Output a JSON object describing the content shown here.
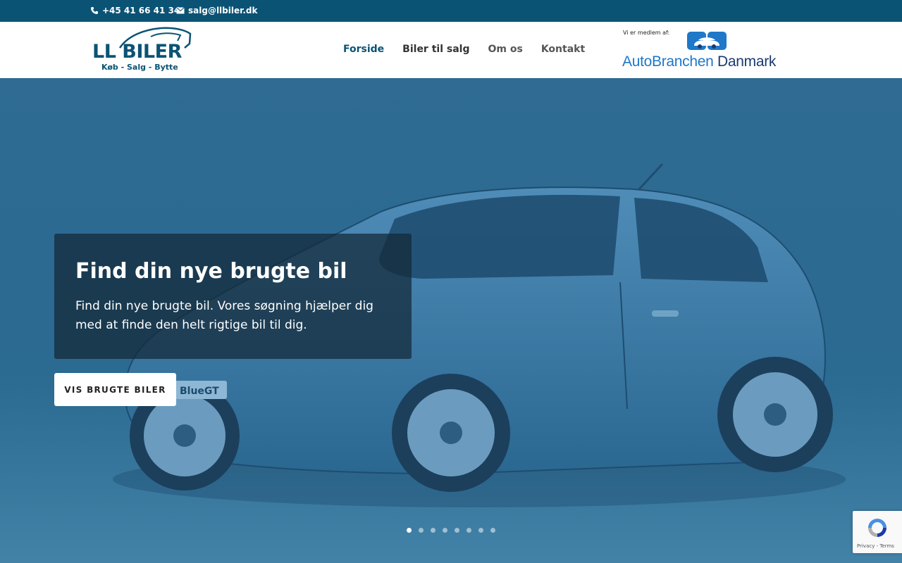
{
  "topbar": {
    "phone": "+45 41 66 41 34",
    "email": "salg@llbiler.dk"
  },
  "logo": {
    "name": "LL BILER",
    "tagline": "Køb - Salg - Bytte"
  },
  "nav": {
    "items": [
      {
        "label": "Forside"
      },
      {
        "label": "Biler til salg"
      },
      {
        "label": "Om os"
      },
      {
        "label": "Kontakt"
      }
    ]
  },
  "member": {
    "label": "Vi er medlem af:",
    "name_part1": "AutoBranchen",
    "name_part2": "Danmark"
  },
  "hero": {
    "title": "Find din nye brugte bil",
    "text": "Find din nye brugte bil. Vores søgning hjælper dig med at finde den helt rigtige bil til dig.",
    "cta": "VIS BRUGTE BILER",
    "plate": "BlueGT",
    "slides_total": 8,
    "active_slide": 1
  },
  "recaptcha": {
    "links": "Privacy - Terms"
  },
  "colors": {
    "primary": "#0b5374",
    "hero_overlay": "#2e6690",
    "abd_blue": "#1f78c8"
  }
}
